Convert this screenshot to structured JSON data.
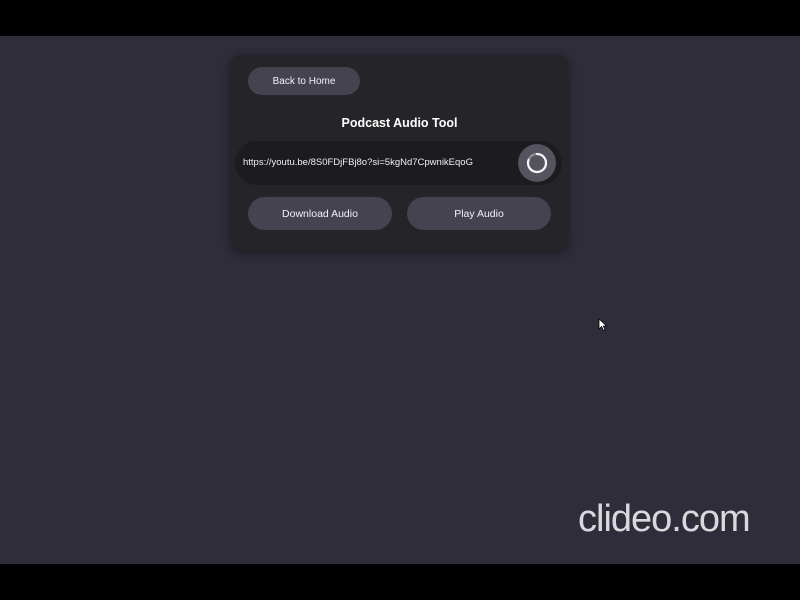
{
  "colors": {
    "stage_background": "#2f2d3a",
    "card_background": "#252428",
    "button_background": "#44434f",
    "input_background": "#1c1b1f",
    "spinner_background": "#55545e",
    "text": "#f2f2f6"
  },
  "card": {
    "back_label": "Back to Home",
    "title": "Podcast Audio Tool",
    "url_value": "https://youtu.be/8S0FDjFBj8o?si=5kgNd7CpwnikEqoG",
    "spinner_icon": "loading-spinner-icon",
    "download_label": "Download Audio",
    "play_label": "Play Audio"
  },
  "cursor_icon": "mouse-pointer-icon",
  "watermark": {
    "text": "clideo.com"
  }
}
